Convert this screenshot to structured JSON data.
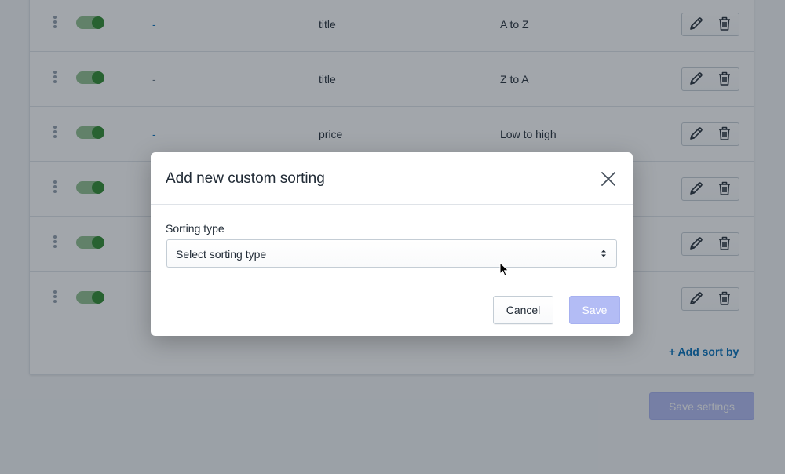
{
  "table": {
    "rows": [
      {
        "name": "-",
        "name_style": "link",
        "field": "title",
        "order": "A to Z"
      },
      {
        "name": "-",
        "name_style": "plain",
        "field": "title",
        "order": "Z to A"
      },
      {
        "name": "-",
        "name_style": "link",
        "field": "price",
        "order": "Low to high"
      },
      {
        "name": "",
        "name_style": "link",
        "field": "",
        "order": ""
      },
      {
        "name": "",
        "name_style": "link",
        "field": "",
        "order": ""
      },
      {
        "name": "",
        "name_style": "link",
        "field": "",
        "order": ""
      }
    ],
    "row_icons": {
      "drag": "drag-handle-icon",
      "toggle": "toggle-switch",
      "edit": "pencil-icon",
      "delete": "trash-icon"
    },
    "add_sort_label": "+ Add sort by"
  },
  "save_settings_label": "Save settings",
  "modal": {
    "title": "Add new custom sorting",
    "close_icon": "close-icon",
    "sorting_type_label": "Sorting type",
    "select": {
      "selected_value": "Select sorting type",
      "icon": "select-arrows-icon"
    },
    "cancel_label": "Cancel",
    "save_label": "Save"
  },
  "colors": {
    "accent_link": "#006fbb",
    "toggle_on": "#2e8b2e",
    "primary_disabled": "#b3bcf5"
  }
}
